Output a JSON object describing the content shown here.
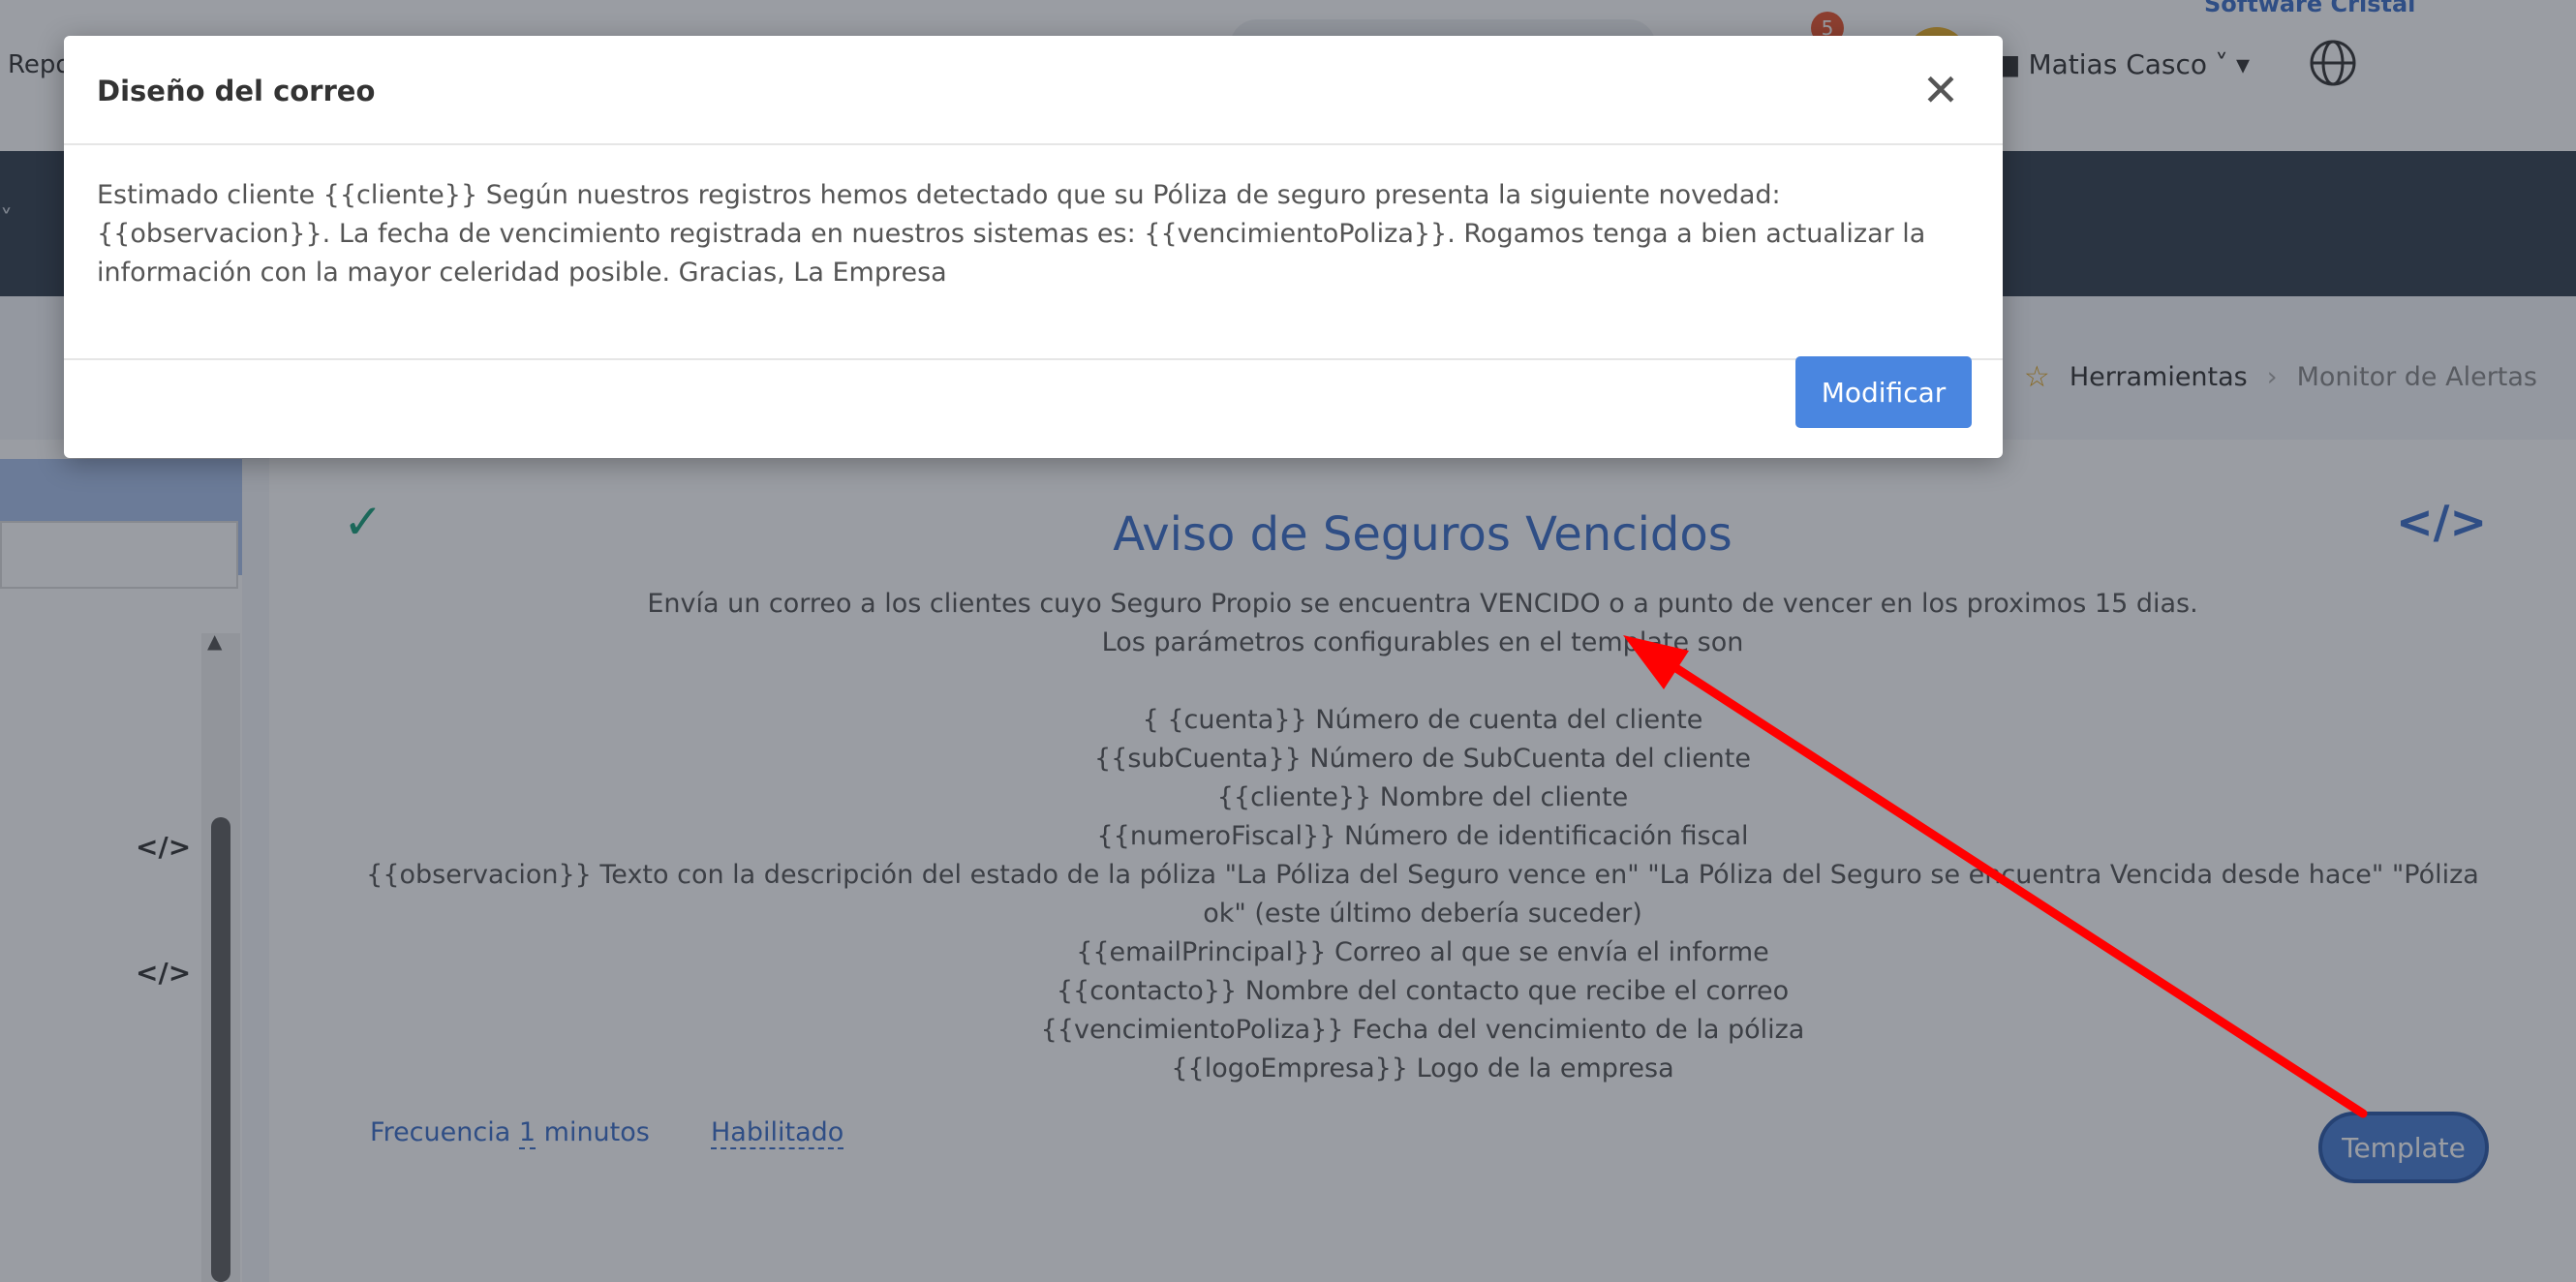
{
  "topbar": {
    "repo_label": "Repo",
    "notification_count": "5",
    "brand": "Software Cristal",
    "user_name": "Matias Casco"
  },
  "breadcrumb": {
    "parent": "Herramientas",
    "current": "Monitor de Alertas"
  },
  "card": {
    "title": "Aviso de Seguros Vencidos",
    "description_lines": [
      "Envía un correo a los clientes cuyo Seguro Propio se encuentra VENCIDO o a punto de vencer en los proximos 15 dias.",
      "Los parámetros configurables en el template son",
      "",
      "{ {cuenta}} Número de cuenta del cliente",
      "{{subCuenta}} Número de SubCuenta del cliente",
      "{{cliente}} Nombre del cliente",
      "{{numeroFiscal}} Número de identificación fiscal",
      "{{observacion}} Texto con la descripción del estado de la póliza \"La Póliza del Seguro vence en\" \"La Póliza del Seguro se encuentra Vencida desde hace\" \"Póliza ok\" (este último debería suceder)",
      "{{emailPrincipal}} Correo al que se envía el informe",
      "{{contacto}} Nombre del contacto que recibe el correo",
      "{{vencimientoPoliza}} Fecha del vencimiento de la póliza",
      "{{logoEmpresa}} Logo de la empresa"
    ],
    "frequency_prefix": "Frecuencia",
    "frequency_value": "1",
    "frequency_unit": "minutos",
    "enabled_label": "Habilitado",
    "template_button": "Template"
  },
  "modal": {
    "title": "Diseño del correo",
    "body": "Estimado cliente {{cliente}} Según nuestros registros hemos detectado que su Póliza de seguro presenta la siguiente novedad: {{observacion}}. La fecha de vencimiento registrada en nuestros sistemas es: {{vencimientoPoliza}}. Rogamos tenga a bien actualizar la información con la mayor celeridad posible. Gracias, La Empresa",
    "button": "Modificar"
  },
  "annotation_color": "#ff0000",
  "icons": [
    "close-icon",
    "check-icon",
    "code-icon",
    "star-icon",
    "globe-icon",
    "user-icon"
  ]
}
